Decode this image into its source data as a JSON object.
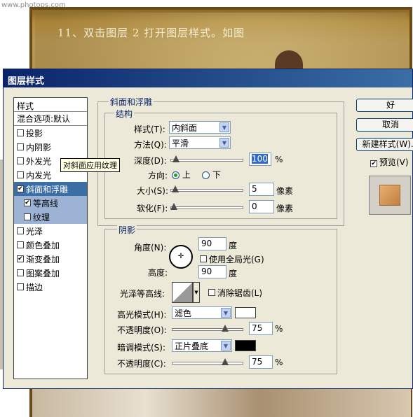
{
  "background": {
    "watermark": "www.photops.com",
    "tutorial_text": "11、双击图层 2 打开图层样式。如图"
  },
  "dialog": {
    "title": "图层样式",
    "style_list": {
      "header": "样式",
      "blend_options": "混合选项:默认",
      "items": [
        {
          "label": "投影",
          "checked": false
        },
        {
          "label": "内阴影",
          "checked": false
        },
        {
          "label": "外发光",
          "checked": false
        },
        {
          "label": "内发光",
          "checked": false
        },
        {
          "label": "斜面和浮雕",
          "checked": true
        },
        {
          "label": "等高线",
          "checked": true
        },
        {
          "label": "纹理",
          "checked": false
        },
        {
          "label": "光泽",
          "checked": false
        },
        {
          "label": "颜色叠加",
          "checked": false
        },
        {
          "label": "渐变叠加",
          "checked": true
        },
        {
          "label": "图案叠加",
          "checked": false
        },
        {
          "label": "描边",
          "checked": false
        }
      ],
      "tooltip": "对斜面应用纹理"
    },
    "bevel": {
      "group_title": "斜面和浮雕",
      "structure_title": "结构",
      "style_label": "样式(T):",
      "style_value": "内斜面",
      "technique_label": "方法(Q):",
      "technique_value": "平滑",
      "depth_label": "深度(D):",
      "depth_value": "100",
      "depth_unit": "%",
      "direction_label": "方向:",
      "direction_up": "上",
      "direction_down": "下",
      "direction_selected": "up",
      "size_label": "大小(S):",
      "size_value": "5",
      "size_unit": "像素",
      "soften_label": "软化(F):",
      "soften_value": "0",
      "soften_unit": "像素"
    },
    "shading": {
      "group_title": "阴影",
      "angle_label": "角度(N):",
      "angle_value": "90",
      "angle_unit": "度",
      "global_light_label": "使用全局光(G)",
      "global_light_checked": false,
      "altitude_label": "高度:",
      "altitude_value": "90",
      "altitude_unit": "度",
      "gloss_contour_label": "光泽等高线:",
      "anti_aliased_label": "消除锯齿(L)",
      "anti_aliased_checked": false,
      "highlight_mode_label": "高光模式(H):",
      "highlight_mode_value": "滤色",
      "highlight_color": "#ffffff",
      "highlight_opacity_label": "不透明度(O):",
      "highlight_opacity_value": "75",
      "highlight_opacity_unit": "%",
      "shadow_mode_label": "暗调模式(S):",
      "shadow_mode_value": "正片叠底",
      "shadow_color": "#000000",
      "shadow_opacity_label": "不透明度(C):",
      "shadow_opacity_value": "75",
      "shadow_opacity_unit": "%"
    },
    "buttons": {
      "ok": "好",
      "cancel": "取消",
      "new_style": "新建样式(W)...",
      "preview_label": "预览(V)",
      "preview_checked": true
    }
  }
}
